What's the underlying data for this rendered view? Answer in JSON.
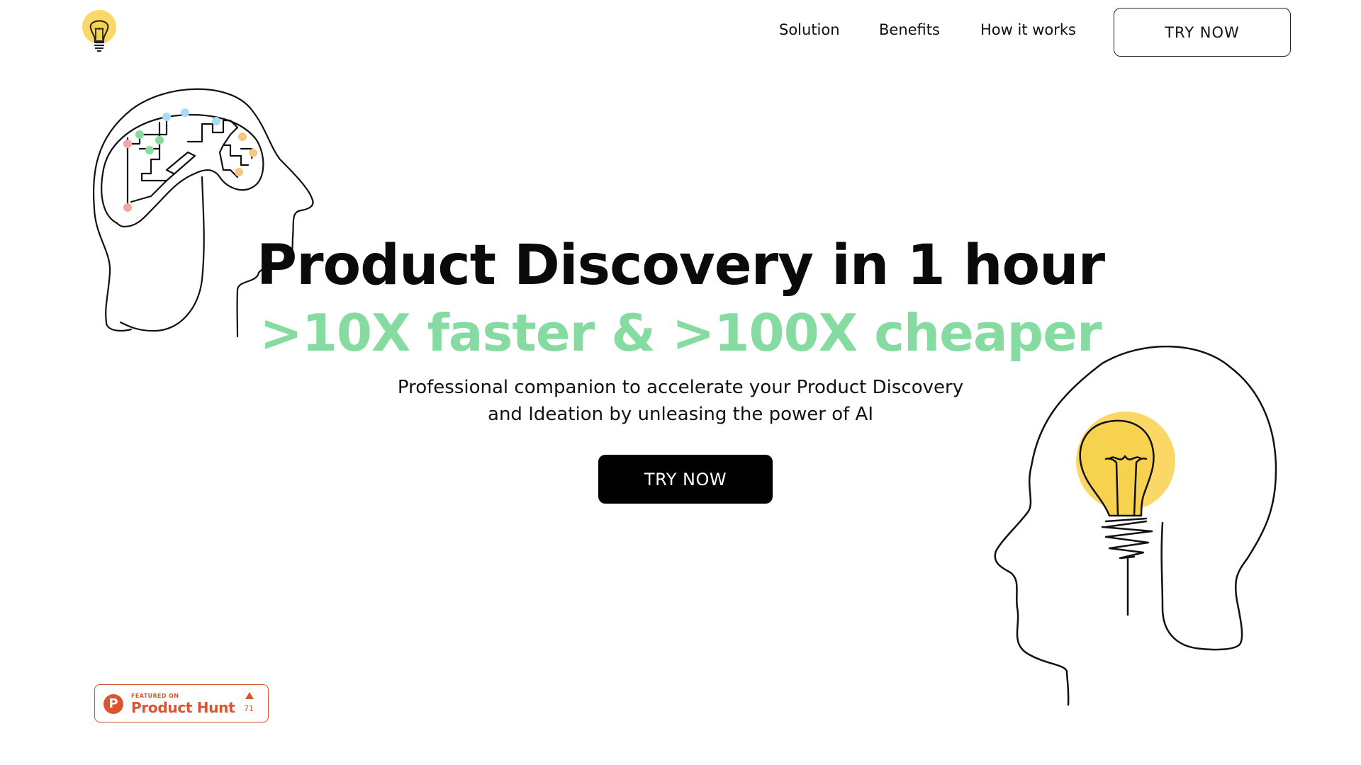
{
  "nav": {
    "logo_icon": "lightbulb-icon",
    "links": [
      "Solution",
      "Benefits",
      "How it works"
    ],
    "cta_label": "TRY NOW"
  },
  "hero": {
    "headline": "Product Discovery in 1 hour",
    "subheadline": ">10X faster & >100X cheaper",
    "description": [
      "Professional companion to accelerate your Product Discovery",
      "and Ideation by unleasing the power of AI"
    ],
    "cta_label": "TRY NOW"
  },
  "illustrations": {
    "left": "brain-circuit-head-icon",
    "right": "lightbulb-head-icon"
  },
  "product_hunt": {
    "featured_text": "FEATURED ON",
    "name": "Product Hunt",
    "logo_letter": "P",
    "upvotes": "71"
  },
  "colors": {
    "accent_green": "#86dba0",
    "bulb_yellow": "#fbd767",
    "product_hunt": "#da552f",
    "cta_bg": "#000000"
  }
}
